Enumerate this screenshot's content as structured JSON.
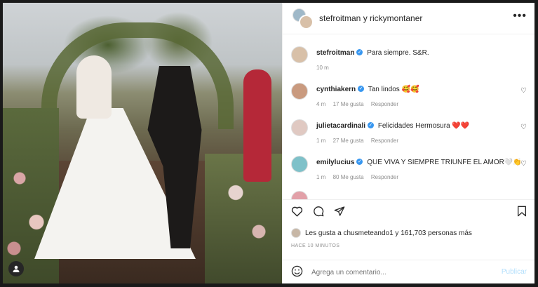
{
  "post": {
    "header_title": "stefroitman y rickymontaner"
  },
  "caption": {
    "user": "stefroitman",
    "text": "Para siempre. S&R.",
    "time": "10 m"
  },
  "comments": [
    {
      "user": "cynthiakern",
      "text": "Tan lindos 🥰🥰",
      "time": "4 m",
      "likes": "17 Me gusta",
      "reply": "Responder",
      "avatar_color": "#c99a7f"
    },
    {
      "user": "julietacardinali",
      "text": "Felicidades Hermosura ❤️❤️",
      "time": "1 m",
      "likes": "27 Me gusta",
      "reply": "Responder",
      "avatar_color": "#e0c9c2"
    },
    {
      "user": "emilylucius",
      "text": "QUE VIVA Y SIEMPRE TRIUNFE EL AMOR🤍👏",
      "time": "1 m",
      "likes": "80 Me gusta",
      "reply": "Responder",
      "avatar_color": "#7fc1c9"
    }
  ],
  "likes": {
    "text": "Les gusta a chusmeteando1 y 161,703 personas más"
  },
  "posted_ago": "HACE 10 MINUTOS",
  "add_comment": {
    "placeholder": "Agrega un comentario...",
    "publish_label": "Publicar"
  },
  "icons": {
    "more": "more-dots-icon",
    "like": "heart-icon",
    "comment": "comment-icon",
    "share": "share-icon",
    "save": "bookmark-icon",
    "emoji": "emoji-icon"
  },
  "colors": {
    "accent": "#0095f6",
    "verified": "#3897f0"
  }
}
